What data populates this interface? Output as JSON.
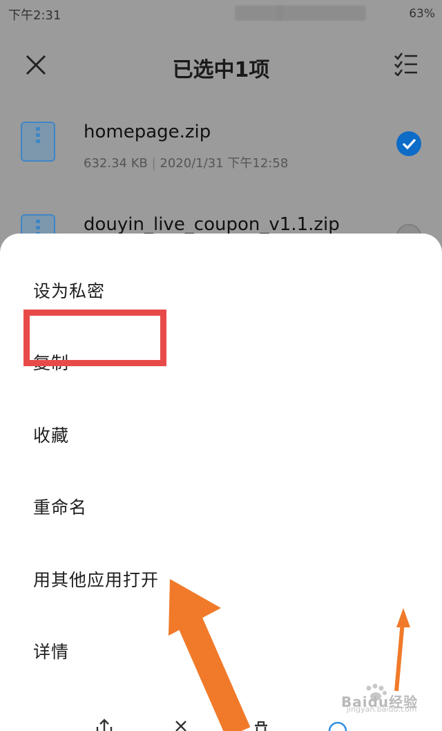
{
  "status_bar": {
    "time": "下午2:31",
    "battery": "63%"
  },
  "header": {
    "title": "已选中1项",
    "close_icon": "close-icon",
    "select_all_icon": "select-all-icon"
  },
  "files": [
    {
      "name": "homepage.zip",
      "size": "632.34 KB",
      "date": "2020/1/31 下午12:58",
      "selected": true
    },
    {
      "name": "douyin_live_coupon_v1.1.zip",
      "selected": false
    }
  ],
  "menu": {
    "items": [
      {
        "label": "设为私密"
      },
      {
        "label": "复制"
      },
      {
        "label": "收藏"
      },
      {
        "label": "重命名"
      },
      {
        "label": "用其他应用打开"
      },
      {
        "label": "详情"
      }
    ]
  },
  "toolbar": {
    "icons": [
      "share-icon",
      "close-icon",
      "delete-icon",
      "more-icon"
    ]
  },
  "watermark": {
    "text": "Baidu经验",
    "url": "jingyan.baidu.com"
  },
  "colors": {
    "accent": "#0c6cc7",
    "highlight": "#e84a4a",
    "arrow": "#f07a2a",
    "dim_background": "#9b9b9b"
  }
}
